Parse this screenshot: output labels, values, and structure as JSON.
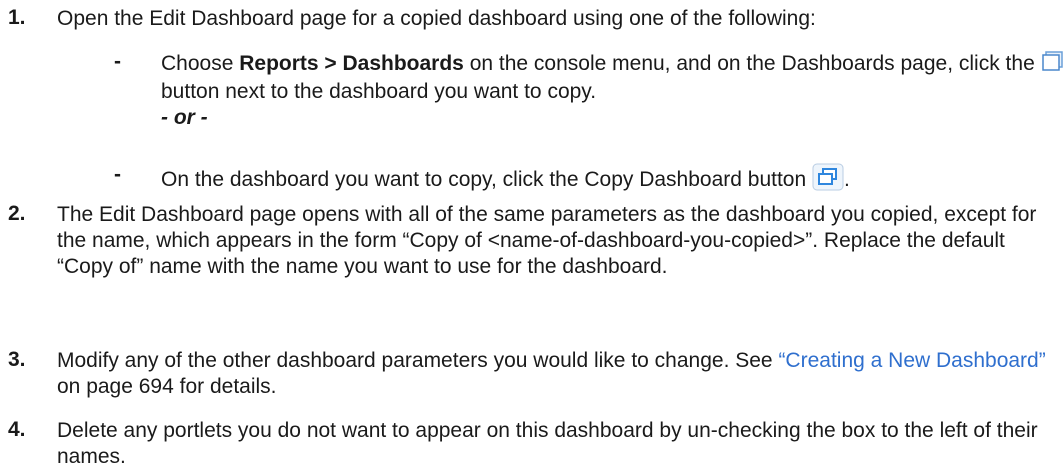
{
  "steps": [
    {
      "number": "1.",
      "text": "Open the Edit Dashboard page for a copied dashboard using one of the following:",
      "options": [
        {
          "bullet": "-",
          "pre": "Choose ",
          "bold": "Reports > Dashboards",
          "mid": " on the console menu, and on the Dashboards page, click the ",
          "icon": "copy-icon",
          "post": " button next to the dashboard you want to copy.",
          "separator": "- or -"
        },
        {
          "bullet": "-",
          "pre": "On the dashboard you want to copy, click the Copy Dashboard button ",
          "icon": "copy-dashboard-button-icon",
          "post": "."
        }
      ]
    },
    {
      "number": "2.",
      "text": "The Edit Dashboard page opens with all of the same parameters as the dashboard you copied, except for the name, which appears in the form “Copy of <name-of-dashboard-you-copied>”. Replace the default “Copy of” name with the name you want to use for the dashboard."
    },
    {
      "number": "3.",
      "pre": "Modify any of the other dashboard parameters you would like to change. See ",
      "link": "“Creating a New Dashboard”",
      "post": " on page 694 for details."
    },
    {
      "number": "4.",
      "text": "Delete any portlets you do not want to appear on this dashboard by un-checking the box to the left of their names."
    }
  ],
  "colors": {
    "link": "#2f6fce",
    "text": "#1a1a1a",
    "icon_blue": "#5b9bd5"
  }
}
